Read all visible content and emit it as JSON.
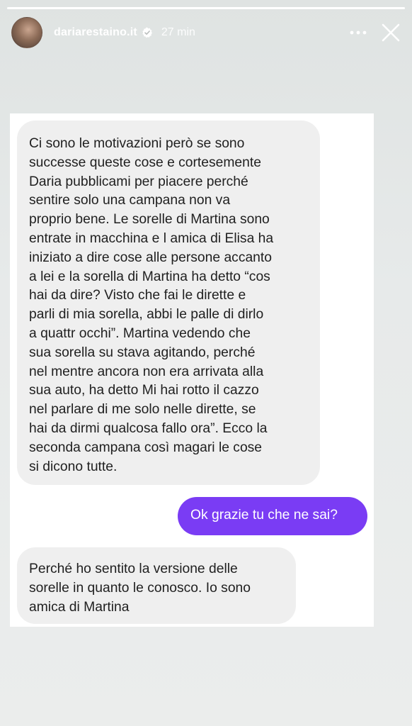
{
  "story": {
    "progress": 1.0,
    "username": "dariarestaino.it",
    "time_ago": "27 min",
    "icons": {
      "verified": "verified-badge-icon",
      "more": "more-options-icon",
      "close": "close-icon"
    }
  },
  "screenshot": {
    "messages": [
      {
        "direction": "incoming",
        "lines": [
          "Ci sono le motivazioni però se sono",
          "successe queste cose e cortesemente",
          "Daria pubblicami per piacere perché",
          "sentire solo una campana non va",
          "proprio bene. Le sorelle di Martina sono",
          "entrate in macchina e l amica di Elisa ha",
          "iniziato a dire cose alle persone accanto",
          "a lei e la sorella di Martina ha detto “cos",
          "hai da dire? Visto che fai le dirette e",
          "parli di mia sorella, abbi le palle di dirlo",
          "a quattr occhi”. Martina vedendo che",
          "sua sorella su stava agitando, perché",
          "nel mentre ancora non era arrivata alla",
          "sua auto, ha detto Mi hai rotto il cazzo",
          "nel parlare di me solo nelle dirette, se",
          "hai da dirmi qualcosa fallo ora”. Ecco la",
          "seconda campana così magari le cose",
          "si dicono tutte."
        ]
      },
      {
        "direction": "outgoing",
        "text": "Ok grazie tu che ne sai?"
      },
      {
        "direction": "incoming",
        "lines": [
          "Perché ho sentito la versione delle",
          "sorelle in quanto le conosco. Io sono",
          "amica di Martina"
        ]
      }
    ]
  },
  "colors": {
    "outgoing_bubble": "#7a3cf4",
    "incoming_bubble": "#efefef",
    "story_background": "#e9ebea"
  }
}
